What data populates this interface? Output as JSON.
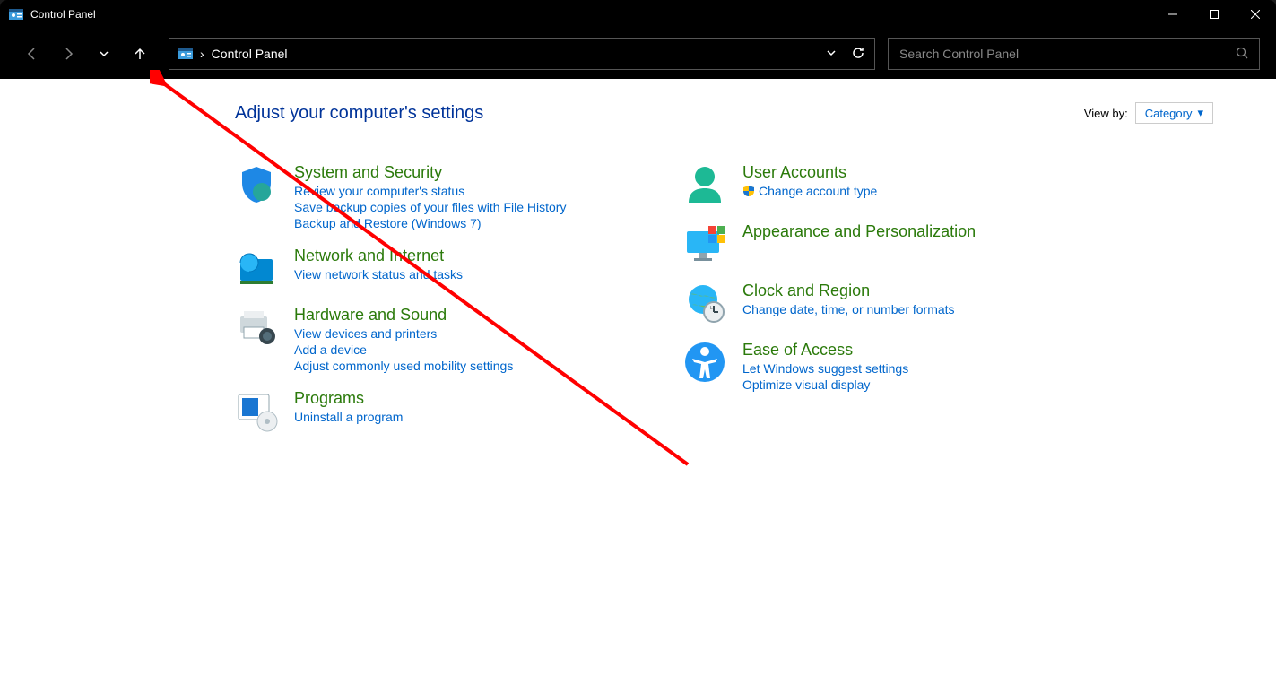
{
  "window": {
    "title": "Control Panel"
  },
  "addressbar": {
    "crumb": "Control Panel"
  },
  "search": {
    "placeholder": "Search Control Panel"
  },
  "header": {
    "title": "Adjust your computer's settings",
    "viewby_label": "View by:",
    "viewby_value": "Category"
  },
  "categories": {
    "left": [
      {
        "title": "System and Security",
        "links": [
          "Review your computer's status",
          "Save backup copies of your files with File History",
          "Backup and Restore (Windows 7)"
        ]
      },
      {
        "title": "Network and Internet",
        "links": [
          "View network status and tasks"
        ]
      },
      {
        "title": "Hardware and Sound",
        "links": [
          "View devices and printers",
          "Add a device",
          "Adjust commonly used mobility settings"
        ]
      },
      {
        "title": "Programs",
        "links": [
          "Uninstall a program"
        ]
      }
    ],
    "right": [
      {
        "title": "User Accounts",
        "links": [
          "Change account type"
        ],
        "shield": [
          true
        ]
      },
      {
        "title": "Appearance and Personalization",
        "links": []
      },
      {
        "title": "Clock and Region",
        "links": [
          "Change date, time, or number formats"
        ]
      },
      {
        "title": "Ease of Access",
        "links": [
          "Let Windows suggest settings",
          "Optimize visual display"
        ]
      }
    ]
  }
}
